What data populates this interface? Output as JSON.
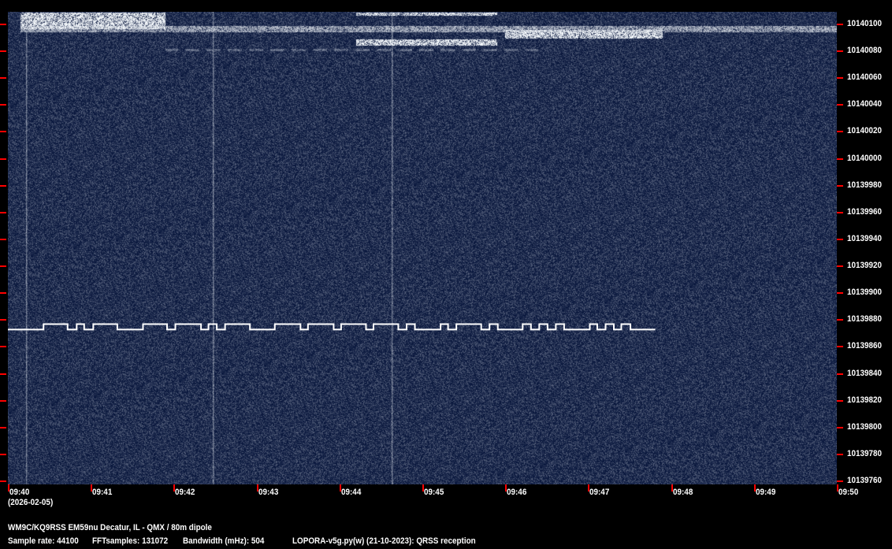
{
  "chart_data": {
    "type": "heatmap",
    "title": "QRSS waterfall",
    "x_axis": {
      "tick_labels": [
        "09:40",
        "09:41",
        "09:42",
        "09:43",
        "09:44",
        "09:45",
        "09:46",
        "09:47",
        "09:48",
        "09:49",
        "09:50"
      ],
      "range_minutes": [
        0,
        10
      ],
      "date_label": "(2026-02-05)"
    },
    "y_axis": {
      "unit": "Hz",
      "range": [
        10139754,
        10140106
      ],
      "tick_labels": [
        "10140100",
        "10140080",
        "10140060",
        "10140040",
        "10140020",
        "10140000",
        "10139980",
        "10139960",
        "10139940",
        "10139920",
        "10139900",
        "10139880",
        "10139860",
        "10139840",
        "10139820",
        "10139800",
        "10139780",
        "10139760"
      ]
    },
    "fsk_trace": {
      "freq_low": 10139870,
      "freq_high": 10139874,
      "start_level": "low",
      "start_min": 0.0,
      "end_min": 7.81,
      "transitions_min": [
        0.43,
        0.72,
        0.83,
        0.92,
        1.03,
        1.32,
        1.63,
        1.92,
        2.02,
        2.33,
        2.42,
        2.52,
        2.62,
        2.92,
        3.22,
        3.53,
        3.62,
        3.93,
        4.02,
        4.32,
        4.41,
        4.71,
        4.81,
        4.91,
        5.22,
        5.31,
        5.41,
        5.71,
        5.81,
        5.91,
        6.21,
        6.31,
        6.41,
        6.51,
        6.61,
        6.71,
        7.02,
        7.11,
        7.21,
        7.31,
        7.4,
        7.51
      ]
    },
    "other_signals": [
      {
        "start_min": 0.15,
        "end_min": 1.9,
        "freq_from": 10140094,
        "freq_to": 10140106,
        "strength": "strong"
      },
      {
        "start_min": 0.15,
        "end_min": 10.0,
        "freq_from": 10140092,
        "freq_to": 10140096,
        "strength": "medium"
      },
      {
        "start_min": 4.2,
        "end_min": 5.9,
        "freq_from": 10140104,
        "freq_to": 10140106,
        "strength": "strong"
      },
      {
        "start_min": 4.2,
        "end_min": 5.9,
        "freq_from": 10140082,
        "freq_to": 10140086,
        "strength": "strong"
      },
      {
        "start_min": 6.0,
        "end_min": 7.9,
        "freq_from": 10140087,
        "freq_to": 10140093,
        "strength": "strong"
      },
      {
        "start_min": 1.9,
        "end_min": 6.4,
        "freq_from": 10140078,
        "freq_to": 10140079,
        "strength": "weak"
      }
    ]
  },
  "footer": {
    "station": "WM9C/KQ9RSS EM59nu Decatur, IL - QMX / 80m dipole",
    "sample_rate": "Sample rate: 44100",
    "fft_samples": "FFTsamples: 131072",
    "bandwidth": "Bandwidth (mHz): 504",
    "software": "LOPORA-v5g.py(w) (21-10-2023): QRSS reception"
  },
  "colors": {
    "background": "#000000",
    "waterfall_base": "#0b1e4a",
    "tick": "#ff0000",
    "signal": "#ffffff"
  }
}
